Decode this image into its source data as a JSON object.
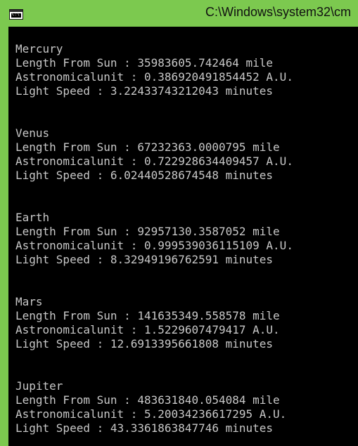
{
  "window": {
    "title": "C:\\Windows\\system32\\cm",
    "icon": "console-app-icon",
    "icon_glyph": "C:\\",
    "accent": "#7cc94f"
  },
  "console": {
    "lines": [
      "Mercury",
      "Length From Sun : 35983605.742464 mile",
      "Astronomicalunit : 0.386920491854452 A.U.",
      "Light Speed : 3.22433743212043 minutes",
      "",
      "",
      "Venus",
      "Length From Sun : 67232363.0000795 mile",
      "Astronomicalunit : 0.722928634409457 A.U.",
      "Light Speed : 6.02440528674548 minutes",
      "",
      "",
      "Earth",
      "Length From Sun : 92957130.3587052 mile",
      "Astronomicalunit : 0.999539036115109 A.U.",
      "Light Speed : 8.32949196762591 minutes",
      "",
      "",
      "Mars",
      "Length From Sun : 141635349.558578 mile",
      "Astronomicalunit : 1.5229607479417 A.U.",
      "Light Speed : 12.6913395661808 minutes",
      "",
      "",
      "Jupiter",
      "Length From Sun : 483631840.054084 mile",
      "Astronomicalunit : 5.20034236617295 A.U.",
      "Light Speed : 43.3361863847746 minutes"
    ]
  }
}
